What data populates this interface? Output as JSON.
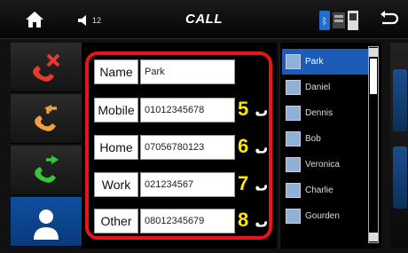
{
  "header": {
    "title": "CALL",
    "volume": "12",
    "home_icon": "home-icon",
    "back_icon": "back-arrow-icon"
  },
  "left_buttons": [
    {
      "name": "call-reject-button",
      "icon": "phone-x-icon",
      "color": "#e33b2e"
    },
    {
      "name": "call-incoming-button",
      "icon": "phone-incoming-icon",
      "color": "#f0a040"
    },
    {
      "name": "call-outgoing-button",
      "icon": "phone-outgoing-icon",
      "color": "#39c63a"
    },
    {
      "name": "contacts-button",
      "icon": "person-icon",
      "color": "#ffffff",
      "active": true
    }
  ],
  "contact": {
    "rows": [
      {
        "label": "Name",
        "value": "Park"
      },
      {
        "label": "Mobile",
        "value": "01012345678",
        "tag": "5"
      },
      {
        "label": "Home",
        "value": "07056780123",
        "tag": "6"
      },
      {
        "label": "Work",
        "value": "021234567",
        "tag": "7"
      },
      {
        "label": "Other",
        "value": "08012345679",
        "tag": "8"
      }
    ]
  },
  "list": {
    "items": [
      "Park",
      "Daniel",
      "Dennis",
      "Bob",
      "Veronica",
      "Charlie",
      "Gourden"
    ],
    "selected_index": 0
  },
  "colors": {
    "highlight": "#e8141b",
    "tag": "#ffe600",
    "selected": "#1c5cb8"
  }
}
